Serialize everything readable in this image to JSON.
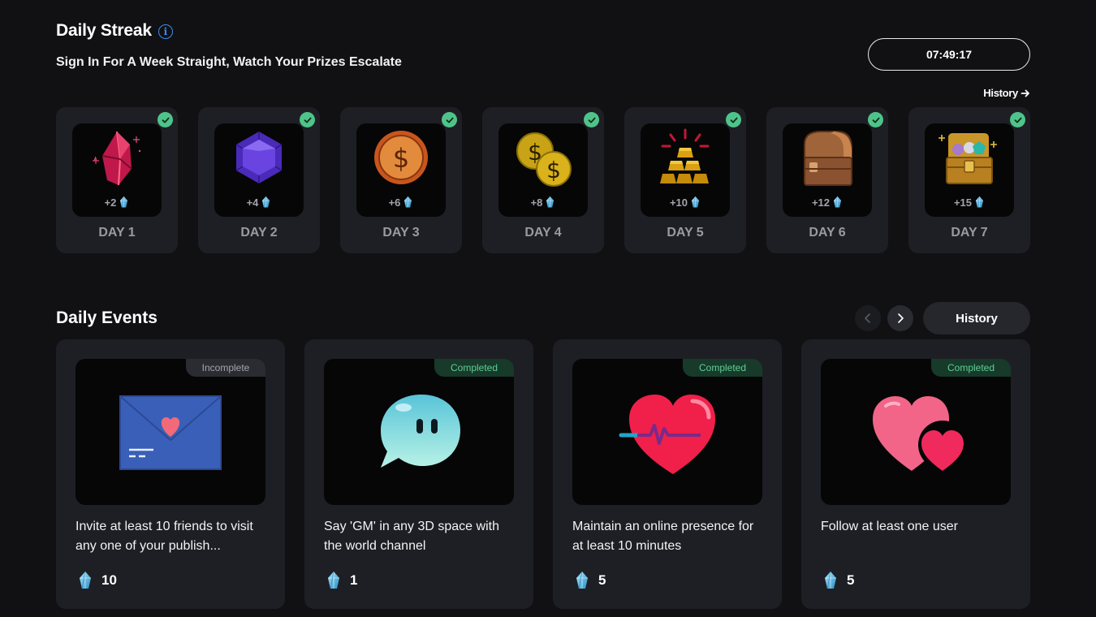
{
  "streak": {
    "title": "Daily Streak",
    "subtitle": "Sign In For A Week Straight, Watch Your Prizes Escalate",
    "timer": "07:49:17",
    "history_label": "History",
    "days": [
      {
        "label": "DAY 1",
        "reward": "+2",
        "icon": "red-gem-icon",
        "completed": true
      },
      {
        "label": "DAY 2",
        "reward": "+4",
        "icon": "purple-gem-icon",
        "completed": true
      },
      {
        "label": "DAY 3",
        "reward": "+6",
        "icon": "bronze-coin-icon",
        "completed": true
      },
      {
        "label": "DAY 4",
        "reward": "+8",
        "icon": "gold-coins-icon",
        "completed": true
      },
      {
        "label": "DAY 5",
        "reward": "+10",
        "icon": "gold-bars-icon",
        "completed": true
      },
      {
        "label": "DAY 6",
        "reward": "+12",
        "icon": "wooden-chest-icon",
        "completed": true
      },
      {
        "label": "DAY 7",
        "reward": "+15",
        "icon": "treasure-chest-icon",
        "completed": true
      }
    ]
  },
  "events": {
    "title": "Daily Events",
    "history_label": "History",
    "items": [
      {
        "status": "Incomplete",
        "text": "Invite at least 10 friends to visit any one of your publish...",
        "reward": "10",
        "icon": "envelope-heart-icon"
      },
      {
        "status": "Completed",
        "text": "Say 'GM' in any 3D space with the world channel",
        "reward": "1",
        "icon": "chat-bubble-icon"
      },
      {
        "status": "Completed",
        "text": "Maintain an online presence for at least 10 minutes",
        "reward": "5",
        "icon": "heartbeat-icon"
      },
      {
        "status": "Completed",
        "text": "Follow at least one user",
        "reward": "5",
        "icon": "two-hearts-icon"
      }
    ]
  },
  "colors": {
    "background": "#111114",
    "card": "#1e1f24",
    "check_green": "#4fc48a",
    "completed_text": "#5fcf94",
    "info_blue": "#3b8cf0"
  }
}
